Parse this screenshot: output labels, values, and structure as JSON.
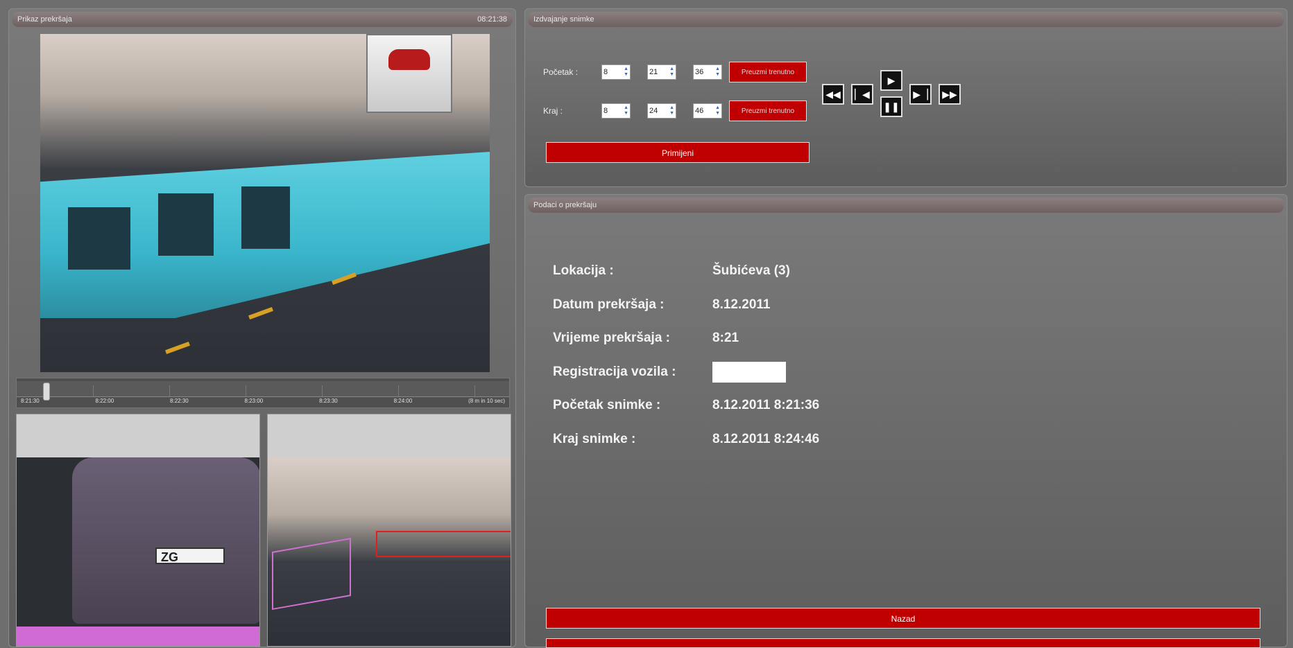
{
  "left_panel": {
    "title": "Prikaz prekršaja",
    "clock": "08:21:38"
  },
  "timeline": {
    "labels": [
      "8:21:30",
      "8:22:00",
      "8:22:30",
      "8:23:00",
      "8:23:30",
      "8:24:00",
      "(8 m in 10 sec)"
    ]
  },
  "thumb_plate": {
    "plate_text": "ZG"
  },
  "extract_panel": {
    "title": "Izdvajanje snimke",
    "start": {
      "label": "Početak :",
      "h": "8",
      "m": "21",
      "s": "36"
    },
    "end": {
      "label": "Kraj :",
      "h": "8",
      "m": "24",
      "s": "46"
    },
    "capture_label": "Preuzmi trenutno",
    "apply_label": "Primijeni"
  },
  "info_panel": {
    "title": "Podaci o prekršaju",
    "rows": [
      {
        "label": "Lokacija :",
        "value": "Šubićeva (3)"
      },
      {
        "label": "Datum prekršaja :",
        "value": "8.12.2011"
      },
      {
        "label": "Vrijeme prekršaja :",
        "value": "8:21"
      },
      {
        "label": "Registracija vozila :",
        "value": ""
      },
      {
        "label": "Početak snimke :",
        "value": "8.12.2011 8:21:36"
      },
      {
        "label": "Kraj snimke :",
        "value": "8.12.2011 8:24:46"
      }
    ],
    "back_label": "Nazad"
  }
}
